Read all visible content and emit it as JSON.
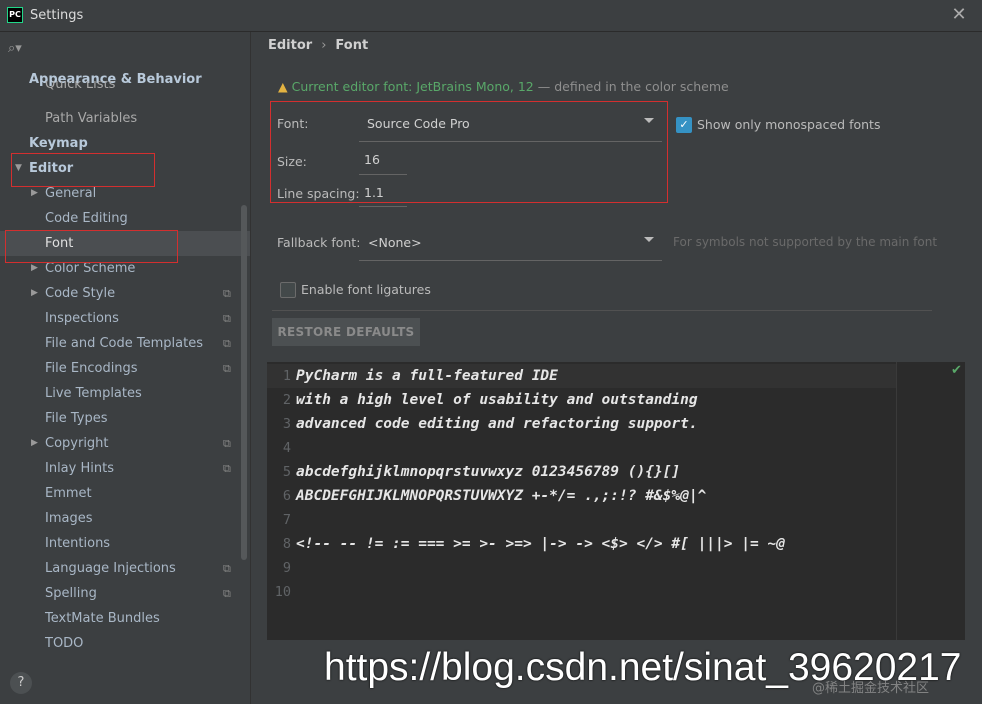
{
  "window": {
    "title": "Settings",
    "app_icon": "pycharm-icon"
  },
  "sidebar": {
    "items": [
      {
        "label": "Appearance & Behavior",
        "kind": "section"
      },
      {
        "label": "Quick Lists",
        "kind": "sub"
      },
      {
        "label": "Path Variables",
        "kind": "sub"
      },
      {
        "label": "Keymap",
        "kind": "section"
      },
      {
        "label": "Editor",
        "kind": "section"
      },
      {
        "label": "General",
        "kind": "child"
      },
      {
        "label": "Code Editing",
        "kind": "child"
      },
      {
        "label": "Font",
        "kind": "child"
      },
      {
        "label": "Color Scheme",
        "kind": "child"
      },
      {
        "label": "Code Style",
        "kind": "child"
      },
      {
        "label": "Inspections",
        "kind": "child"
      },
      {
        "label": "File and Code Templates",
        "kind": "child"
      },
      {
        "label": "File Encodings",
        "kind": "child"
      },
      {
        "label": "Live Templates",
        "kind": "child"
      },
      {
        "label": "File Types",
        "kind": "child"
      },
      {
        "label": "Copyright",
        "kind": "child"
      },
      {
        "label": "Inlay Hints",
        "kind": "child"
      },
      {
        "label": "Emmet",
        "kind": "child"
      },
      {
        "label": "Images",
        "kind": "child"
      },
      {
        "label": "Intentions",
        "kind": "child"
      },
      {
        "label": "Language Injections",
        "kind": "child"
      },
      {
        "label": "Spelling",
        "kind": "child"
      },
      {
        "label": "TextMate Bundles",
        "kind": "child"
      },
      {
        "label": "TODO",
        "kind": "child"
      }
    ],
    "help_label": "?"
  },
  "breadcrumb": {
    "parent": "Editor",
    "separator": "›",
    "current": "Font"
  },
  "warning": {
    "highlight": "Current editor font: JetBrains Mono, 12",
    "rest": " — defined in the color scheme"
  },
  "font": {
    "label": "Font:",
    "value": "Source Code Pro"
  },
  "monospaced": {
    "label": "Show only monospaced fonts",
    "checked": true
  },
  "size": {
    "label": "Size:",
    "value": "16"
  },
  "line_spacing": {
    "label": "Line spacing:",
    "value": "1.1"
  },
  "fallback": {
    "label": "Fallback font:",
    "value": "<None>",
    "hint": "For symbols not supported by the main font"
  },
  "ligatures": {
    "label": "Enable font ligatures",
    "checked": false
  },
  "restore_label": "RESTORE DEFAULTS",
  "preview": {
    "lines": [
      {
        "n": "1",
        "text": "PyCharm is a full-featured IDE"
      },
      {
        "n": "2",
        "text": "with a high level of usability and outstanding"
      },
      {
        "n": "3",
        "text": "advanced code editing and refactoring support."
      },
      {
        "n": "4",
        "text": ""
      },
      {
        "n": "5",
        "text": "abcdefghijklmnopqrstuvwxyz 0123456789 (){}[]"
      },
      {
        "n": "6",
        "text": "ABCDEFGHIJKLMNOPQRSTUVWXYZ +-*/= .,;:!? #&$%@|^"
      },
      {
        "n": "7",
        "text": ""
      },
      {
        "n": "8",
        "text": "<!-- -- != := === >= >- >=> |-> -> <$> </> #[ |||> |= ~@"
      },
      {
        "n": "9",
        "text": ""
      },
      {
        "n": "10",
        "text": ""
      }
    ]
  },
  "watermark": {
    "url": "https://blog.csdn.net/sinat_39620217",
    "small": "@稀土掘金技术社区"
  },
  "colors": {
    "accent": "#3592c4",
    "highlight_box": "#d32f2f",
    "warning_text": "#59a869"
  }
}
